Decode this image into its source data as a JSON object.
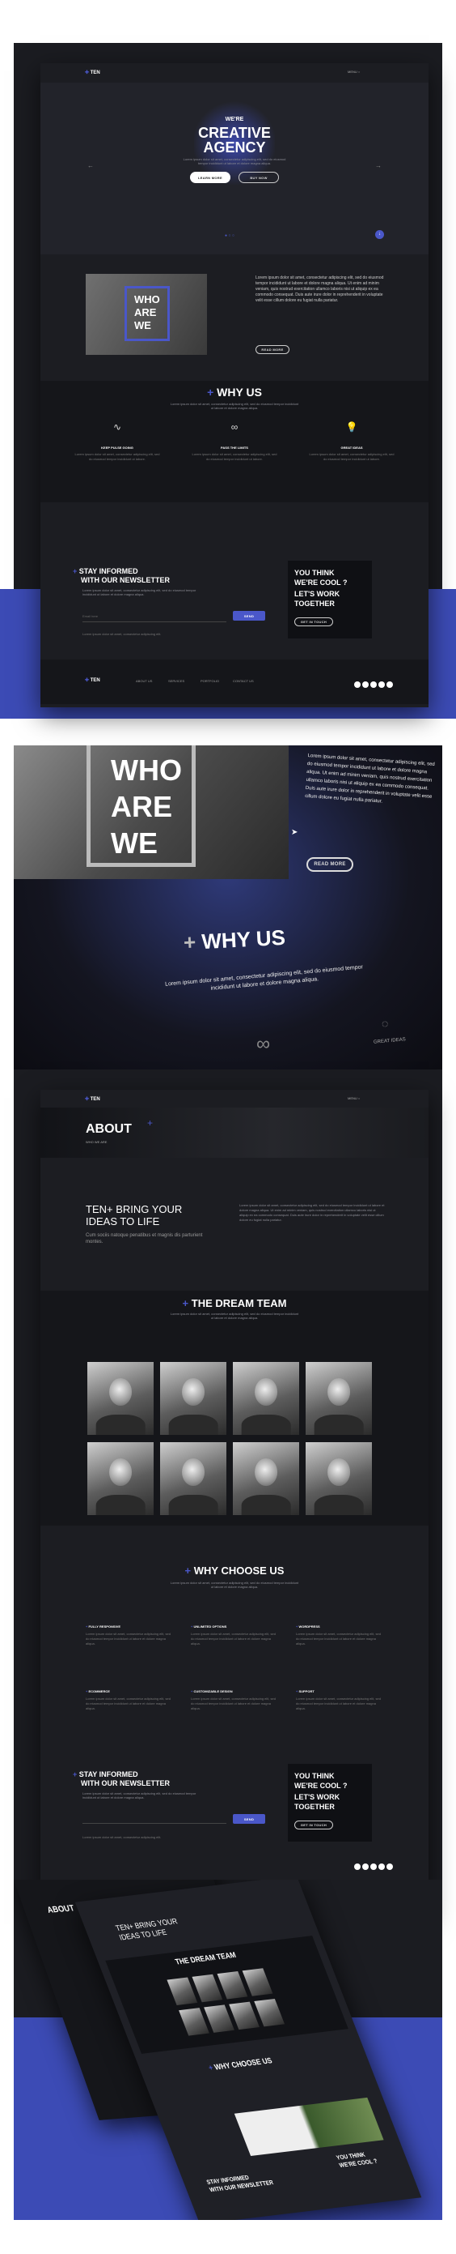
{
  "home": {
    "logo": "TEN",
    "menu_label": "MENU",
    "hero": {
      "kicker": "WE'RE",
      "title_line1": "CREATIVE",
      "title_line2": "AGENCY",
      "subtitle": "Lorem ipsum dolor sit amet, consectetur adipiscing elit, sed do eiusmod tempor incididunt ut labore et dolore magna aliqua.",
      "btn_learn": "LEARN MORE",
      "btn_buy": "BUY NOW"
    },
    "who": {
      "word1": "WHO",
      "word2": "ARE",
      "word3": "WE",
      "body": "Lorem ipsum dolor sit amet, consectetur adipiscing elit, sed do eiusmod tempor incididunt ut labore et dolore magna aliqua. Ut enim ad minim veniam, quis nostrud exercitation ullamco laboris nisi ut aliquip ex ea commodo consequat. Duis aute irure dolor in reprehenderit in voluptate velit esse cillum dolore eu fugiat nulla pariatur.",
      "btn": "READ MORE"
    },
    "why": {
      "title": "WHY US",
      "subtitle": "Lorem ipsum dolor sit amet, consectetur adipiscing elit, sed do eiusmod tempor incididunt ut labore et dolore magna aliqua.",
      "features": [
        {
          "icon": "pulse-icon",
          "title": "KEEP PULSE GOING",
          "text": "Lorem ipsum dolor sit amet, consectetur adipiscing elit, sed do eiusmod tempor incididunt ut labore."
        },
        {
          "icon": "infinity-icon",
          "title": "PASS THE LIMITS",
          "text": "Lorem ipsum dolor sit amet, consectetur adipiscing elit, sed do eiusmod tempor incididunt ut labore."
        },
        {
          "icon": "lightbulb-icon",
          "title": "GREAT IDEAS",
          "text": "Lorem ipsum dolor sit amet, consectetur adipiscing elit, sed do eiusmod tempor incididunt ut labore."
        }
      ]
    },
    "newsletter": {
      "title_line1": "STAY INFORMED",
      "title_line2": "WITH OUR NEWSLETTER",
      "text": "Lorem ipsum dolor sit amet, consectetur adipiscing elit, sed do eiusmod tempor incididunt ut labore et dolore magna aliqua.",
      "placeholder": "Email here",
      "btn": "SEND",
      "note": "Lorem ipsum dolor sit amet, consectetur adipiscing elit."
    },
    "cta": {
      "line1": "YOU THINK",
      "line2": "WE'RE COOL ?",
      "line3": "LET'S WORK",
      "line4": "TOGETHER",
      "btn": "GET IN TOUCH"
    },
    "footer": {
      "links": [
        "ABOUT US",
        "SERVICES",
        "PORTFOLIO",
        "CONTACT US"
      ]
    }
  },
  "closeup": {
    "word1": "WHO",
    "word2": "ARE",
    "word3": "WE",
    "body": "Lorem ipsum dolor sit amet, consectetur adipiscing elit, sed do eiusmod tempor incididunt ut labore et dolore magna aliqua. Ut enim ad minim veniam, quis nostrud exercitation ullamco laboris nisi ut aliquip ex ea commodo consequat. Duis aute irure dolor in reprehenderit in voluptate velit esse cillum dolore eu fugiat nulla pariatur.",
    "btn": "READ MORE",
    "why_title": "WHY US",
    "why_text": "Lorem ipsum dolor sit amet, consectetur adipiscing elit, sed do eiusmod tempor incididunt ut labore et dolore magna aliqua.",
    "great_ideas": "GREAT IDEAS"
  },
  "about": {
    "logo": "TEN",
    "menu_label": "MENU",
    "title": "ABOUT",
    "subtitle": "WHO WE ARE",
    "intro_line1": "TEN+ BRING YOUR",
    "intro_line2": "IDEAS TO LIFE",
    "intro_sub": "Cum sociis natoque penatibus et magnis dis parturient montes.",
    "intro_body": "Lorem ipsum dolor sit amet, consectetur adipiscing elit, sed do eiusmod tempor incididunt ut labore et dolore magna aliqua. Ut enim ad minim veniam, quis nostrud exercitation ullamco laboris nisi ut aliquip ex ea commodo consequat. Duis aute irure dolor in reprehenderit in voluptate velit esse cillum dolore eu fugiat nulla pariatur.",
    "team_title": "THE DREAM TEAM",
    "team_sub": "Lorem ipsum dolor sit amet, consectetur adipiscing elit, sed do eiusmod tempor incididunt ut labore et dolore magna aliqua.",
    "choose_title": "WHY CHOOSE US",
    "choose_sub": "Lorem ipsum dolor sit amet, consectetur adipiscing elit, sed do eiusmod tempor incididunt ut labore et dolore magna aliqua.",
    "choose_items": [
      {
        "title": "FULLY RESPONSIVE",
        "text": "Lorem ipsum dolor sit amet, consectetur adipiscing elit, sed do eiusmod tempor incididunt ut labore et dolore magna aliqua."
      },
      {
        "title": "UNLIMITED OPTIONS",
        "text": "Lorem ipsum dolor sit amet, consectetur adipiscing elit, sed do eiusmod tempor incididunt ut labore et dolore magna aliqua."
      },
      {
        "title": "WORDPRESS",
        "text": "Lorem ipsum dolor sit amet, consectetur adipiscing elit, sed do eiusmod tempor incididunt ut labore et dolore magna aliqua."
      },
      {
        "title": "ECOMMERCE",
        "text": "Lorem ipsum dolor sit amet, consectetur adipiscing elit, sed do eiusmod tempor incididunt ut labore et dolore magna aliqua."
      },
      {
        "title": "CUSTOMIZABLE DESIGN",
        "text": "Lorem ipsum dolor sit amet, consectetur adipiscing elit, sed do eiusmod tempor incididunt ut labore et dolore magna aliqua."
      },
      {
        "title": "SUPPORT",
        "text": "Lorem ipsum dolor sit amet, consectetur adipiscing elit, sed do eiusmod tempor incididunt ut labore et dolore magna aliqua."
      }
    ],
    "newsletter_line1": "STAY INFORMED",
    "newsletter_line2": "WITH OUR NEWSLETTER",
    "newsletter_text": "Lorem ipsum dolor sit amet, consectetur adipiscing elit, sed do eiusmod tempor incididunt ut labore et dolore magna aliqua.",
    "newsletter_btn": "SEND",
    "newsletter_note": "Lorem ipsum dolor sit amet, consectetur adipiscing elit.",
    "cta_line1": "YOU THINK",
    "cta_line2": "WE'RE COOL ?",
    "cta_line3": "LET'S WORK",
    "cta_line4": "TOGETHER",
    "cta_btn": "GET IN TOUCH"
  },
  "perspective": {
    "about": "ABOUT",
    "intro_line1": "TEN+ BRING YOUR",
    "intro_line2": "IDEAS TO LIFE",
    "team_title": "THE DREAM TEAM",
    "choose_title": "WHY CHOOSE US",
    "newsletter_line1": "STAY INFORMED",
    "newsletter_line2": "WITH OUR NEWSLETTER",
    "cta_line1": "YOU THINK",
    "cta_line2": "WE'RE COOL ?"
  },
  "colors": {
    "accent": "#4a57c9",
    "dark": "#17181c",
    "panel": "#1e1f25"
  }
}
